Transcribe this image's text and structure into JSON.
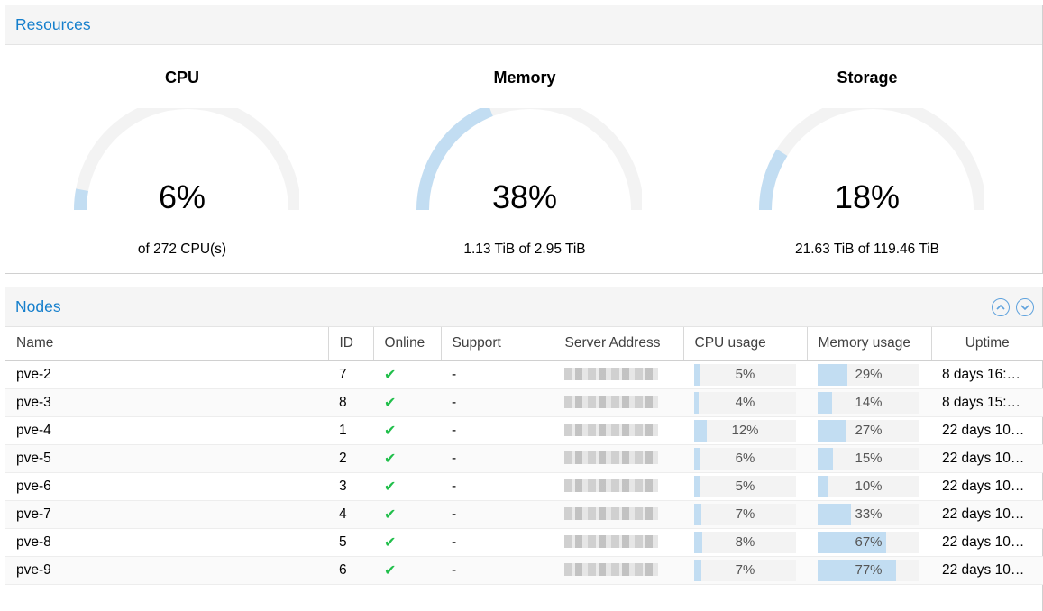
{
  "resources": {
    "title": "Resources",
    "gauges": [
      {
        "title": "CPU",
        "value": "6%",
        "fraction": 0.06,
        "subtext": "of 272 CPU(s)"
      },
      {
        "title": "Memory",
        "value": "38%",
        "fraction": 0.38,
        "subtext": "1.13 TiB of 2.95 TiB"
      },
      {
        "title": "Storage",
        "value": "18%",
        "fraction": 0.18,
        "subtext": "21.63 TiB of 119.46 TiB"
      }
    ],
    "colors": {
      "gauge_track": "#f3f3f3",
      "gauge_fill": "#c2ddf2"
    }
  },
  "nodes": {
    "title": "Nodes",
    "columns": [
      "Name",
      "ID",
      "Online",
      "Support",
      "Server Address",
      "CPU usage",
      "Memory usage",
      "Uptime"
    ],
    "rows": [
      {
        "name": "pve-2",
        "id": "7",
        "support": "-",
        "cpu": "5%",
        "cpu_frac": 0.05,
        "mem": "29%",
        "mem_frac": 0.29,
        "uptime": "8 days 16:…"
      },
      {
        "name": "pve-3",
        "id": "8",
        "support": "-",
        "cpu": "4%",
        "cpu_frac": 0.04,
        "mem": "14%",
        "mem_frac": 0.14,
        "uptime": "8 days 15:…"
      },
      {
        "name": "pve-4",
        "id": "1",
        "support": "-",
        "cpu": "12%",
        "cpu_frac": 0.12,
        "mem": "27%",
        "mem_frac": 0.27,
        "uptime": "22 days 10…"
      },
      {
        "name": "pve-5",
        "id": "2",
        "support": "-",
        "cpu": "6%",
        "cpu_frac": 0.06,
        "mem": "15%",
        "mem_frac": 0.15,
        "uptime": "22 days 10…"
      },
      {
        "name": "pve-6",
        "id": "3",
        "support": "-",
        "cpu": "5%",
        "cpu_frac": 0.05,
        "mem": "10%",
        "mem_frac": 0.1,
        "uptime": "22 days 10…"
      },
      {
        "name": "pve-7",
        "id": "4",
        "support": "-",
        "cpu": "7%",
        "cpu_frac": 0.07,
        "mem": "33%",
        "mem_frac": 0.33,
        "uptime": "22 days 10…"
      },
      {
        "name": "pve-8",
        "id": "5",
        "support": "-",
        "cpu": "8%",
        "cpu_frac": 0.08,
        "mem": "67%",
        "mem_frac": 0.67,
        "uptime": "22 days 10…"
      },
      {
        "name": "pve-9",
        "id": "6",
        "support": "-",
        "cpu": "7%",
        "cpu_frac": 0.07,
        "mem": "77%",
        "mem_frac": 0.77,
        "uptime": "22 days 10…"
      }
    ],
    "online_icon": "check-icon",
    "tools": [
      "collapse-up-icon",
      "expand-down-icon"
    ],
    "colors": {
      "online": "#21bf4b",
      "bar_fill": "#c2ddf2",
      "bar_track": "#f3f3f3",
      "title": "#157fcc"
    }
  }
}
